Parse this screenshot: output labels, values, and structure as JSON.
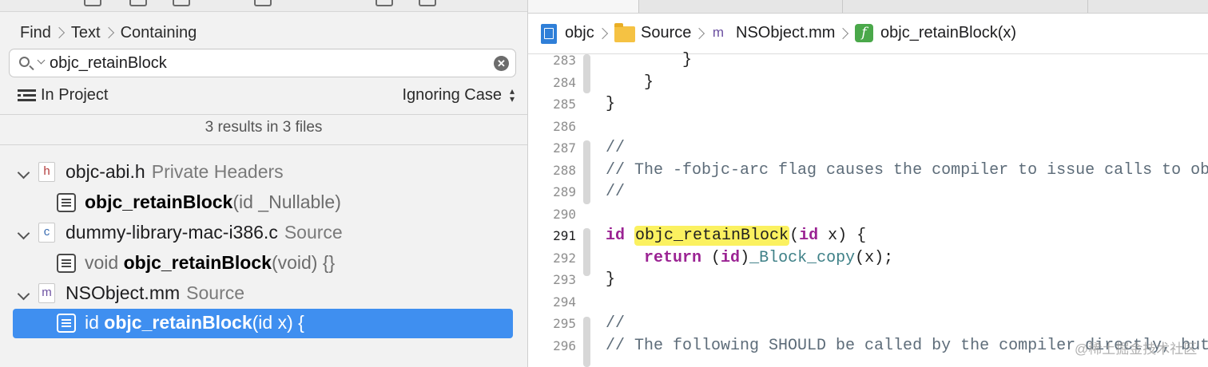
{
  "find_navigator": {
    "breadcrumb": [
      "Find",
      "Text",
      "Containing"
    ],
    "search": {
      "value": "objc_retainBlock"
    },
    "scope_label": "In Project",
    "case_label": "Ignoring Case",
    "results_summary": "3 results in 3 files",
    "file_results": [
      {
        "icon_letter": "h",
        "file": "objc-abi.h",
        "group": "Private Headers",
        "match": {
          "prefix": "",
          "symbol": "objc_retainBlock",
          "suffix": "(id _Nullable)",
          "selected": false
        }
      },
      {
        "icon_letter": "c",
        "file": "dummy-library-mac-i386.c",
        "group": "Source",
        "match": {
          "prefix": "void ",
          "symbol": "objc_retainBlock",
          "suffix": "(void) {}",
          "selected": false
        }
      },
      {
        "icon_letter": "m",
        "file": "NSObject.mm",
        "group": "Source",
        "match": {
          "prefix": "id ",
          "symbol": "objc_retainBlock",
          "suffix": "(id x) {",
          "selected": true
        }
      }
    ]
  },
  "editor": {
    "jump_bar": {
      "project": "objc",
      "folder": "Source",
      "file_icon_letter": "m",
      "file": "NSObject.mm",
      "func_icon_glyph": "f",
      "symbol": "objc_retainBlock(x)"
    },
    "current_line": 291,
    "lines": [
      {
        "n": 283,
        "text": "        }"
      },
      {
        "n": 284,
        "text": "    }"
      },
      {
        "n": 285,
        "text": "}"
      },
      {
        "n": 286,
        "text": ""
      },
      {
        "n": 287,
        "text": "//"
      },
      {
        "n": 288,
        "text": "// The -fobjc-arc flag causes the compiler to issue calls to objc_"
      },
      {
        "n": 289,
        "text": "//"
      },
      {
        "n": 290,
        "text": ""
      },
      {
        "n": 291,
        "text": "id objc_retainBlock(id x) {"
      },
      {
        "n": 292,
        "text": "    return (id)_Block_copy(x);"
      },
      {
        "n": 293,
        "text": "}"
      },
      {
        "n": 294,
        "text": ""
      },
      {
        "n": 295,
        "text": "//"
      },
      {
        "n": 296,
        "text": "// The following SHOULD be called by the compiler directly, but t"
      }
    ],
    "highlight_term": "objc_retainBlock"
  },
  "watermark": "@稀土掘金技术社区",
  "colors": {
    "selection": "#3f8ff0",
    "keyword": "#9b2393",
    "comment": "#5d6c79",
    "function": "#3e8087",
    "match_highlight": "#fbf160"
  }
}
